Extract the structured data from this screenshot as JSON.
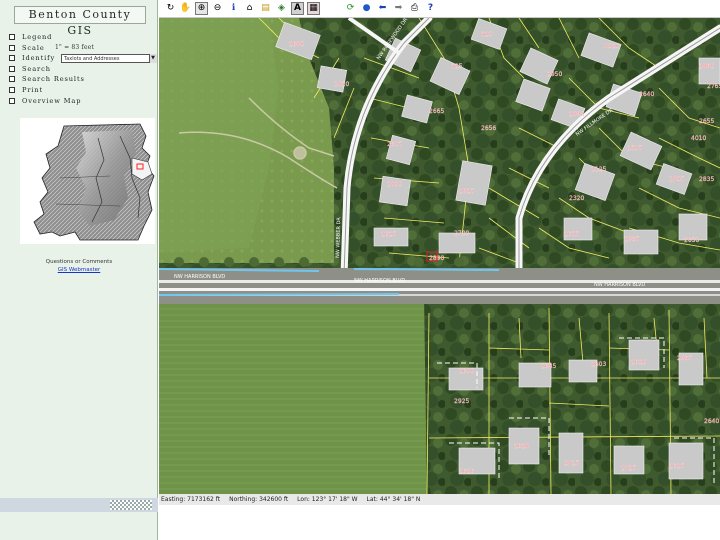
{
  "app": {
    "title": "Benton County GIS"
  },
  "menu": {
    "items": [
      {
        "label": "Legend"
      },
      {
        "label": "Scale",
        "extra": "1\" = 83 feet"
      },
      {
        "label": "Identify",
        "select_value": "Taxlots and Addresses"
      },
      {
        "label": "Search"
      },
      {
        "label": "Search Results"
      },
      {
        "label": "Print"
      },
      {
        "label": "Overview Map"
      }
    ]
  },
  "sidebar": {
    "questions_text": "Questions or Comments",
    "contact_link": "GIS Webmaster"
  },
  "toolbar": {
    "icons": [
      "refresh-icon",
      "pan-hand-icon",
      "zoom-in-icon",
      "zoom-out-icon",
      "info-icon",
      "measure-icon",
      "folder-icon",
      "layers-icon",
      "label-icon",
      "select-icon",
      "redraw-icon",
      "globe-icon",
      "back-arrow-icon",
      "forward-arrow-icon",
      "print-icon",
      "help-icon"
    ]
  },
  "map": {
    "street_labels": [
      "NW ROSEWOOD DR",
      "NW FILLMORE DR",
      "NW WEBBER DR",
      "NW HARRISON BLVD",
      "NW HARRISON BLVD",
      "NW HARRISON BLVD"
    ],
    "parcels": [
      {
        "number": "2680"
      },
      {
        "number": "420"
      },
      {
        "number": "425"
      },
      {
        "number": "3020"
      },
      {
        "number": "2950"
      },
      {
        "number": "1810"
      },
      {
        "number": "2640"
      },
      {
        "number": "2860"
      },
      {
        "number": "2665"
      },
      {
        "number": "2995"
      },
      {
        "number": "2635"
      },
      {
        "number": "2656"
      },
      {
        "number": "4010"
      },
      {
        "number": "1535"
      },
      {
        "number": "2835"
      },
      {
        "number": "2125"
      },
      {
        "number": "2830"
      },
      {
        "number": "2925"
      },
      {
        "number": "1805"
      },
      {
        "number": "2320"
      },
      {
        "number": "2965"
      },
      {
        "number": "2625"
      },
      {
        "number": "2720"
      },
      {
        "number": "2650"
      },
      {
        "number": "2655"
      },
      {
        "number": "2890"
      },
      {
        "number": "2765"
      },
      {
        "number": "2655"
      },
      {
        "number": "2630"
      },
      {
        "number": "2685"
      },
      {
        "number": "2603"
      },
      {
        "number": "2610"
      },
      {
        "number": "2965"
      },
      {
        "number": "2925"
      },
      {
        "number": "2628"
      },
      {
        "number": "2815"
      },
      {
        "number": "2815"
      },
      {
        "number": "2615"
      },
      {
        "number": "2626"
      },
      {
        "number": "2640"
      }
    ]
  },
  "status": {
    "easting": "Easting: 7173162 ft",
    "northing": "Northing: 342600 ft",
    "lon": "Lon: 123° 17' 18\" W",
    "lat": "Lat: 44° 34' 18\" N"
  },
  "colors": {
    "sidebar_bg": "#e8f2e8",
    "parcel_line": "#f2ec62",
    "parcel_label": "#e0202c",
    "water_line": "#6fc7ef",
    "link": "#1a34c8"
  }
}
